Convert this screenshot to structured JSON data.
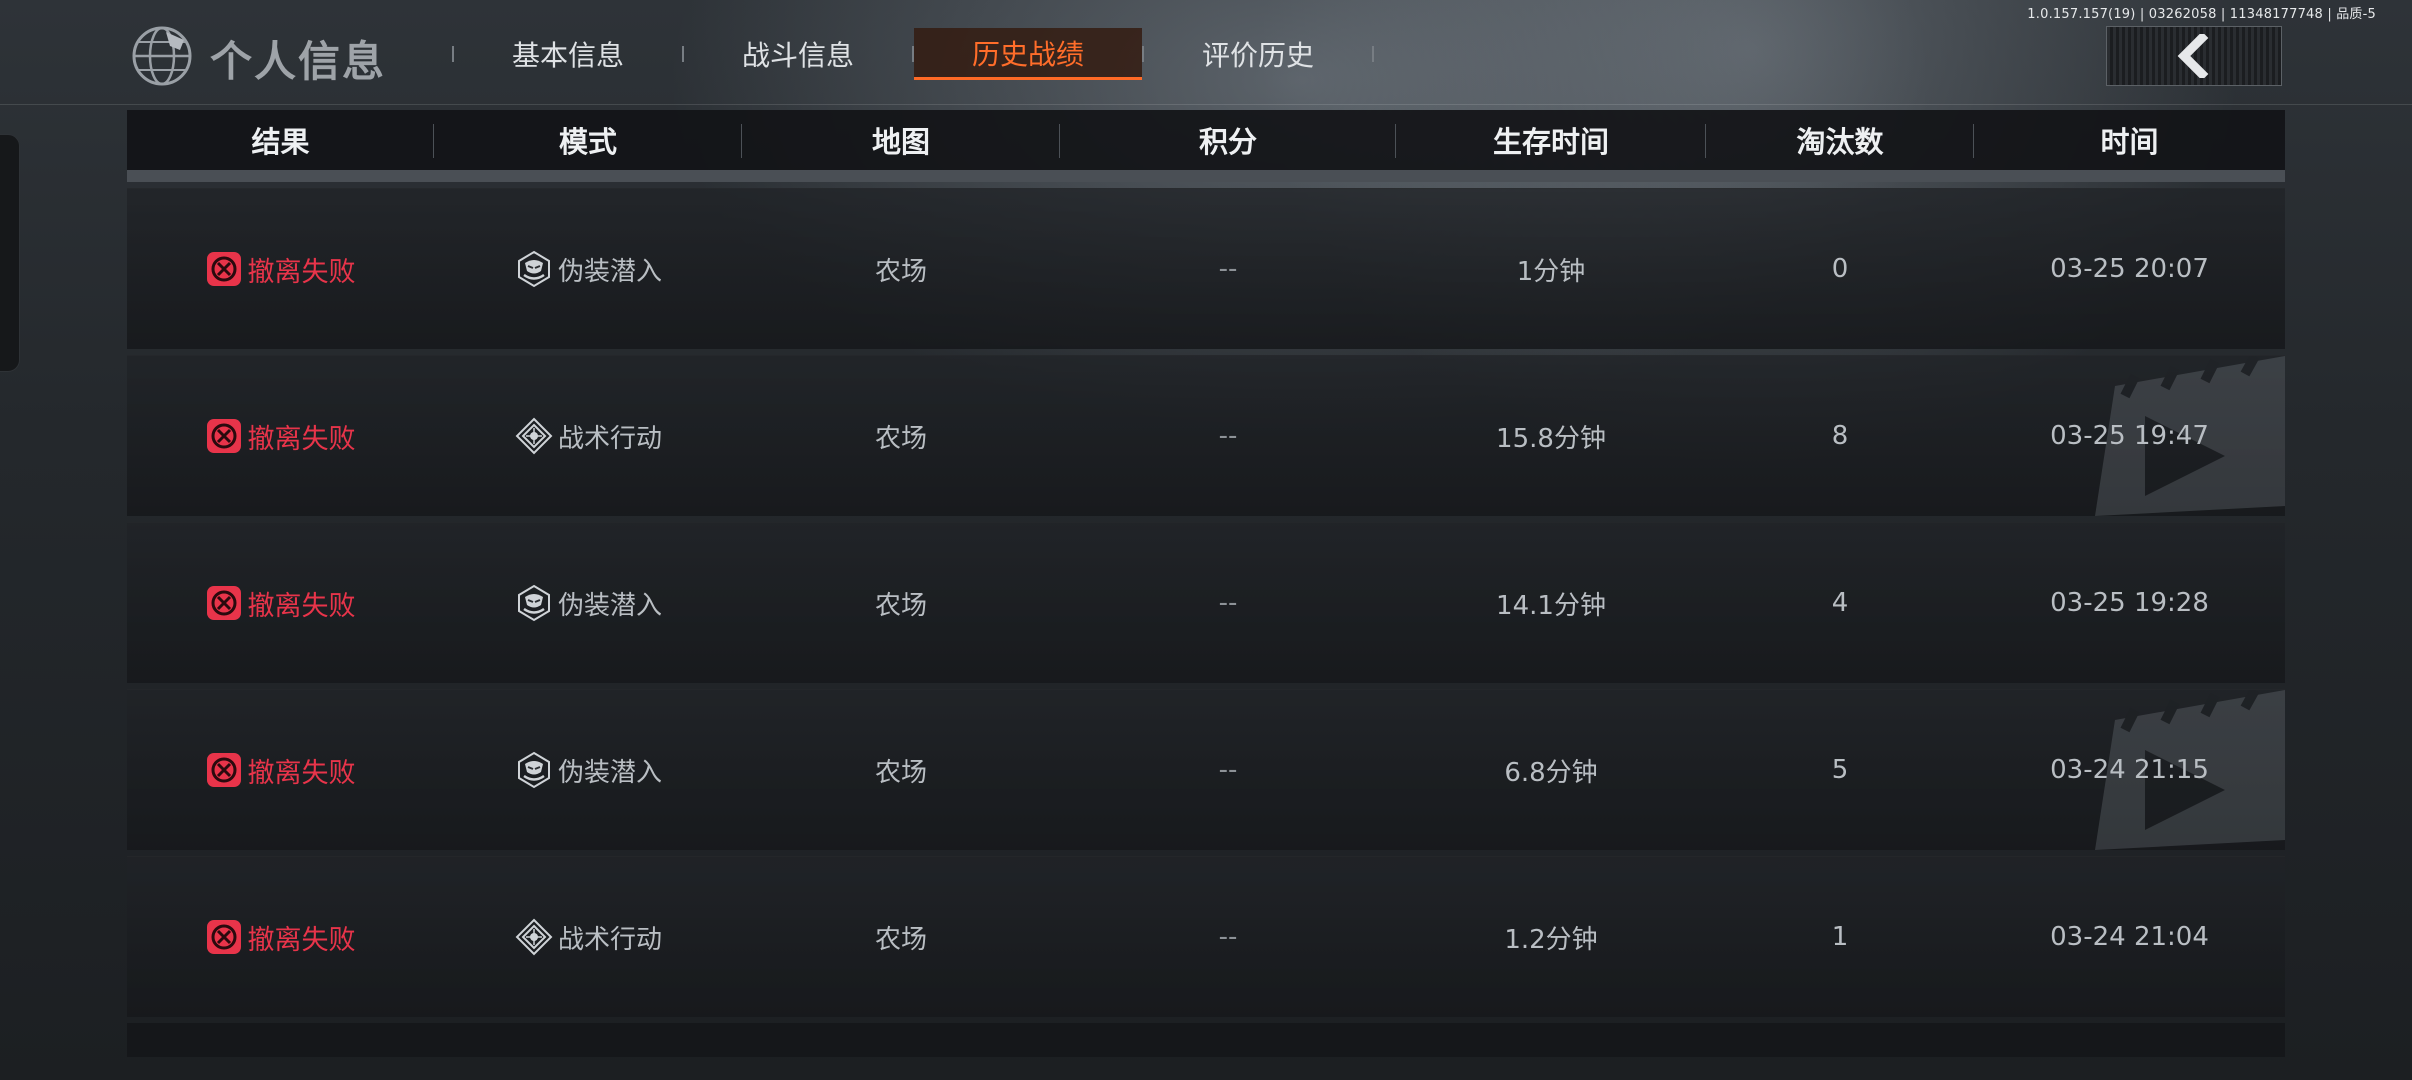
{
  "version": "1.0.157.157(19) | 03262058 | 11348177748 | 品质-5",
  "header": {
    "title": "个人信息",
    "tabs": [
      {
        "label": "基本信息",
        "active": false
      },
      {
        "label": "战斗信息",
        "active": false
      },
      {
        "label": "历史战绩",
        "active": true
      },
      {
        "label": "评价历史",
        "active": false
      }
    ],
    "accent": "#ff6a26"
  },
  "table": {
    "columns": [
      "结果",
      "模式",
      "地图",
      "积分",
      "生存时间",
      "淘汰数",
      "时间"
    ],
    "rows": [
      {
        "result": "撤离失败",
        "mode": "伪装潜入",
        "mode_icon": "disguise-icon",
        "map": "农场",
        "score": "--",
        "survival": "1分钟",
        "kills": "0",
        "time": "03-25 20:07"
      },
      {
        "result": "撤离失败",
        "mode": "战术行动",
        "mode_icon": "tactical-icon",
        "map": "农场",
        "score": "--",
        "survival": "15.8分钟",
        "kills": "8",
        "time": "03-25 19:47"
      },
      {
        "result": "撤离失败",
        "mode": "伪装潜入",
        "mode_icon": "disguise-icon",
        "map": "农场",
        "score": "--",
        "survival": "14.1分钟",
        "kills": "4",
        "time": "03-25 19:28"
      },
      {
        "result": "撤离失败",
        "mode": "伪装潜入",
        "mode_icon": "disguise-icon",
        "map": "农场",
        "score": "--",
        "survival": "6.8分钟",
        "kills": "5",
        "time": "03-24 21:15"
      },
      {
        "result": "撤离失败",
        "mode": "战术行动",
        "mode_icon": "tactical-icon",
        "map": "农场",
        "score": "--",
        "survival": "1.2分钟",
        "kills": "1",
        "time": "03-24 21:04"
      }
    ],
    "result_color": "#e8344a"
  }
}
